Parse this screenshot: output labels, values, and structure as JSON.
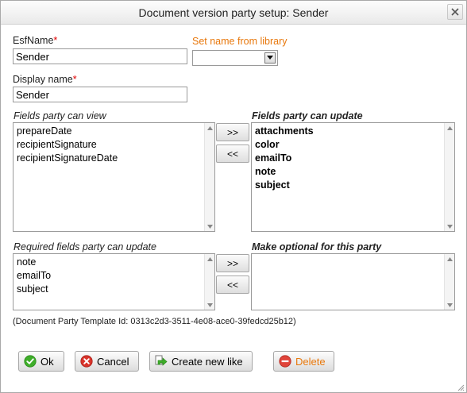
{
  "dialog": {
    "title": "Document version party setup: Sender"
  },
  "form": {
    "esfname_label": "EsfName",
    "esfname_value": "Sender",
    "library_label": "Set name from library",
    "library_selected": "",
    "display_name_label": "Display name",
    "display_name_value": "Sender",
    "required_marker": "*"
  },
  "lists": {
    "view_label": "Fields party can view",
    "view_items": [
      "prepareDate",
      "recipientSignature",
      "recipientSignatureDate"
    ],
    "update_label": "Fields party can update",
    "update_items": [
      "attachments",
      "color",
      "emailTo",
      "note",
      "subject"
    ],
    "required_label": "Required fields party can update",
    "required_items": [
      "note",
      "emailTo",
      "subject"
    ],
    "optional_label": "Make optional for this party",
    "optional_items": []
  },
  "move_buttons": {
    "to_right": ">>",
    "to_left": "<<"
  },
  "template_id_text": "(Document Party Template Id: 0313c2d3-3511-4e08-ace0-39fedcd25b12)",
  "buttons": {
    "ok": "Ok",
    "cancel": "Cancel",
    "create_new_like": "Create new like",
    "delete": "Delete"
  },
  "colors": {
    "required_star": "#e00000",
    "library_link": "#e8780c",
    "delete_disabled": "#e8780c",
    "ok_icon": "#3fae2a",
    "cancel_icon": "#d9342b"
  }
}
